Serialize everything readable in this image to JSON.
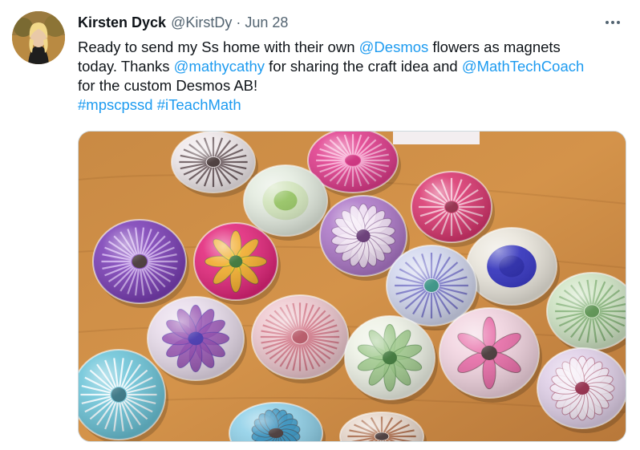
{
  "author": {
    "name": "Kirsten Dyck",
    "handle": "@KirstDy",
    "separator": "·",
    "date": "Jun 28",
    "avatar_icon": "profile-photo"
  },
  "more_icon": "more-horizontal-icon",
  "tweet": {
    "line1": {
      "t1": "Ready to send my Ss home with their own ",
      "m1": "@Desmos",
      "t2": " flowers as magnets"
    },
    "line2": {
      "t1": "today. Thanks ",
      "m1": "@mathycathy",
      "t2": " for sharing the craft idea and ",
      "m2": "@MathTechCoach"
    },
    "line3": {
      "t1": "for the custom Desmos AB!"
    },
    "line4": {
      "h1": "#mpscpssd",
      "sp": " ",
      "h2": "#iTeachMath"
    }
  },
  "media": {
    "description_icon": "photo-of-glass-flower-magnets",
    "colors": {
      "table": "#c9843c",
      "link": "#1d9bf0"
    }
  }
}
